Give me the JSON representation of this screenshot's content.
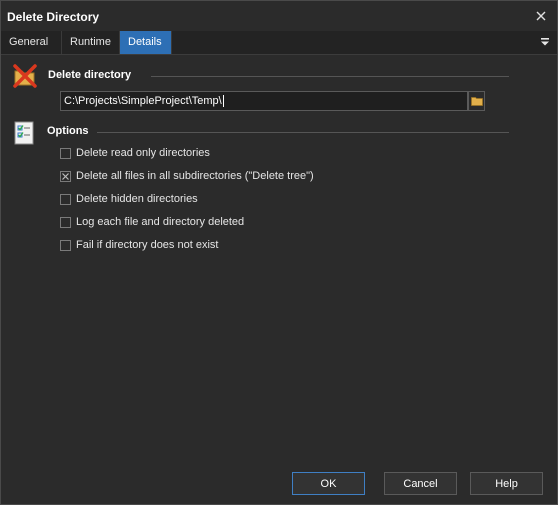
{
  "window": {
    "title": "Delete Directory"
  },
  "tabs": [
    {
      "label": "General"
    },
    {
      "label": "Runtime"
    },
    {
      "label": "Details",
      "active": true
    }
  ],
  "delete_section": {
    "title": "Delete directory",
    "path_value": "C:\\Projects\\SimpleProject\\Temp\\"
  },
  "options_section": {
    "title": "Options",
    "items": [
      {
        "label": "Delete read only directories",
        "checked": false
      },
      {
        "label": "Delete all files in all subdirectories (\"Delete tree\")",
        "checked": true
      },
      {
        "label": "Delete hidden directories",
        "checked": false
      },
      {
        "label": "Log each file and directory deleted",
        "checked": false
      },
      {
        "label": "Fail if directory does not exist",
        "checked": false
      }
    ]
  },
  "buttons": {
    "ok": "OK",
    "cancel": "Cancel",
    "help": "Help"
  },
  "colors": {
    "accent": "#2d6fb5",
    "background": "#2b2b2b",
    "text": "#e6e6e6"
  }
}
